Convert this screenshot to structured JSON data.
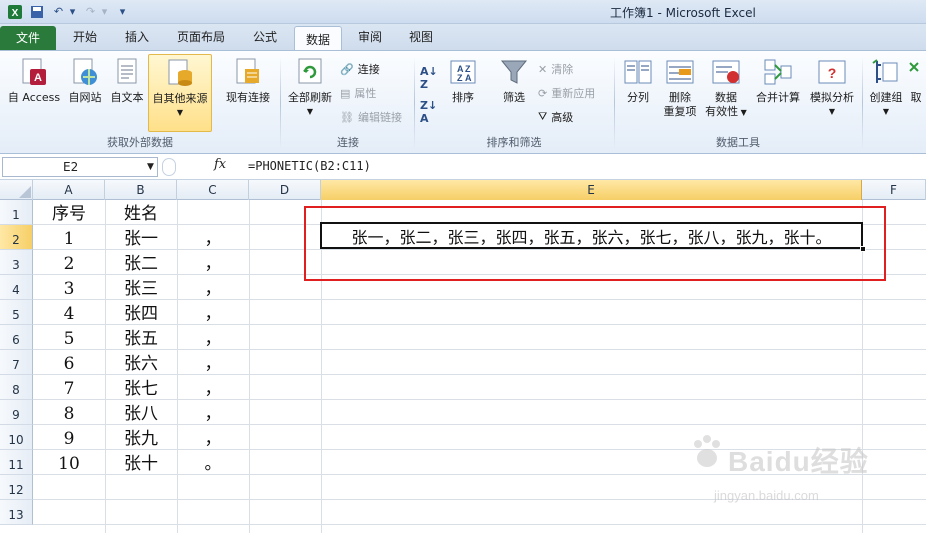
{
  "window": {
    "title": "工作簿1 - Microsoft Excel"
  },
  "tabs": [
    "文件",
    "开始",
    "插入",
    "页面布局",
    "公式",
    "数据",
    "审阅",
    "视图"
  ],
  "active_tab": "数据",
  "ribbon": {
    "get_external": {
      "group_label": "获取外部数据",
      "access": "自 Access",
      "web": "自网站",
      "text": "自文本",
      "other": "自其他来源",
      "existing": "现有连接"
    },
    "connections": {
      "group_label": "连接",
      "refresh_all": "全部刷新",
      "connections": "连接",
      "properties": "属性",
      "edit_links": "编辑链接"
    },
    "sort_filter": {
      "group_label": "排序和筛选",
      "sort": "排序",
      "filter": "筛选",
      "clear": "清除",
      "reapply": "重新应用",
      "advanced": "高级"
    },
    "data_tools": {
      "group_label": "数据工具",
      "text_to_columns": "分列",
      "remove_dup_1": "删除",
      "remove_dup_2": "重复项",
      "validation_1": "数据",
      "validation_2": "有效性",
      "consolidate": "合并计算",
      "what_if": "模拟分析"
    },
    "outline": {
      "group": "创建组",
      "ungroup": "取"
    }
  },
  "formula_bar": {
    "name_box": "E2",
    "fx": "fx",
    "formula": "=PHONETIC(B2:C11)"
  },
  "columns": [
    "A",
    "B",
    "C",
    "D",
    "E",
    "F"
  ],
  "rows": [
    "1",
    "2",
    "3",
    "4",
    "5",
    "6",
    "7",
    "8",
    "9",
    "10",
    "11",
    "12",
    "13"
  ],
  "cells": {
    "A": [
      "序号",
      "1",
      "2",
      "3",
      "4",
      "5",
      "6",
      "7",
      "8",
      "9",
      "10"
    ],
    "B": [
      "姓名",
      "张一",
      "张二",
      "张三",
      "张四",
      "张五",
      "张六",
      "张七",
      "张八",
      "张九",
      "张十"
    ],
    "C": [
      "",
      "，",
      "，",
      "，",
      "，",
      "，",
      "，",
      "，",
      "，",
      "，",
      "。"
    ],
    "E2": "张一，张二，张三，张四，张五，张六，张七，张八，张九，张十。"
  },
  "watermark": {
    "brand": "Baidu经验",
    "url": "jingyan.baidu.com"
  },
  "colors": {
    "file_tab": "#2a7a3c",
    "highlight_box": "#e02020",
    "selected_header": "#f6cf66"
  }
}
